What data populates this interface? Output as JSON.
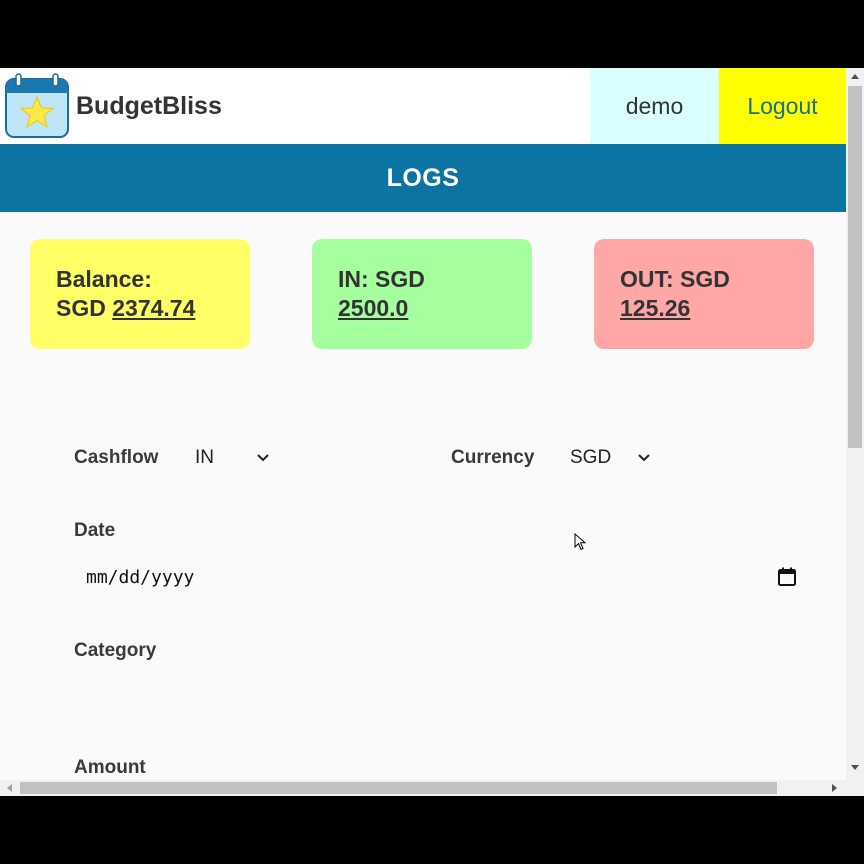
{
  "header": {
    "brand_name": "BudgetBliss",
    "username": "demo",
    "logout_label": "Logout"
  },
  "banner": {
    "title": "LOGS"
  },
  "summary": {
    "balance": {
      "label_line1": "Balance:",
      "currency": "SGD",
      "value": "2374.74"
    },
    "in": {
      "label": "IN: SGD",
      "value": "2500.0"
    },
    "out": {
      "label": "OUT: SGD",
      "value": "125.26"
    }
  },
  "form": {
    "cashflow_label": "Cashflow",
    "cashflow_value": "IN",
    "currency_label": "Currency",
    "currency_value": "SGD",
    "date_label": "Date",
    "date_placeholder": "mm/dd/yyyy",
    "category_label": "Category",
    "amount_label": "Amount"
  },
  "colors": {
    "banner": "#0b74a3",
    "logout_bg": "#ffff00",
    "user_bg": "#d9ffff",
    "balance_card": "#ffff66",
    "in_card": "#a5ff9f",
    "out_card": "#ffa7a7"
  },
  "icons": [
    "calendar-star-logo-icon",
    "chevron-down-icon",
    "calendar-icon",
    "mouse-cursor-icon"
  ]
}
